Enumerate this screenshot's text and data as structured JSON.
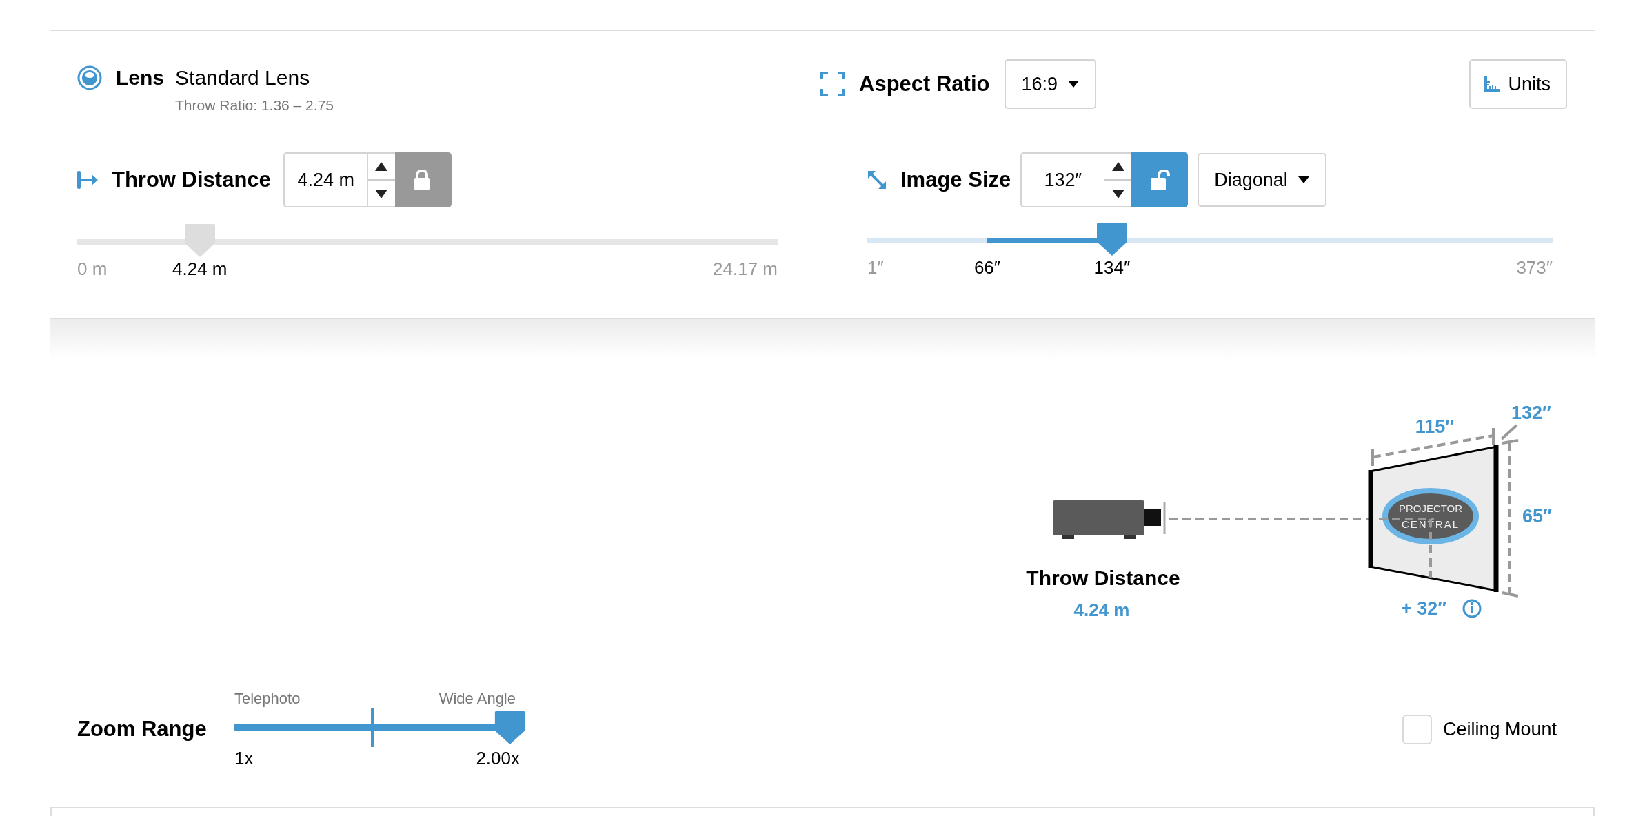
{
  "lens": {
    "label": "Lens",
    "name": "Standard Lens",
    "throw_ratio": "Throw Ratio: 1.36 – 2.75"
  },
  "aspect_ratio": {
    "label": "Aspect Ratio",
    "value": "16:9"
  },
  "units_button": {
    "label": "Units"
  },
  "throw_distance": {
    "label": "Throw Distance",
    "value": "4.24 m",
    "locked": true,
    "slider": {
      "level": 0.175,
      "min_label": "0 m",
      "value_label": "4.24 m",
      "max_label": "24.17 m"
    }
  },
  "image_size": {
    "label": "Image Size",
    "value": "132″",
    "locked": false,
    "measure": "Diagonal",
    "slider": {
      "level": 0.357,
      "range_start": {
        "level": 0.175
      },
      "min_label": "1″",
      "range_start_label": "66″",
      "value_label": "134″",
      "max_label": "373″"
    }
  },
  "diagram": {
    "throw_label": "Throw Distance",
    "throw_value": "4.24 m",
    "width": "115″",
    "diagonal": "132″",
    "height": "65″",
    "offset": "+ 32″",
    "logo_lines": [
      "PROJECTOR",
      "CENTRAL"
    ]
  },
  "zoom_range": {
    "label": "Zoom Range",
    "low_caption": "Telephoto",
    "high_caption": "Wide Angle",
    "low_value": "1x",
    "high_value": "2.00x",
    "level": 1.0,
    "midpoint": {
      "level": 0.495
    }
  },
  "ceiling_mount": {
    "label": "Ceiling Mount",
    "checked": false
  }
}
